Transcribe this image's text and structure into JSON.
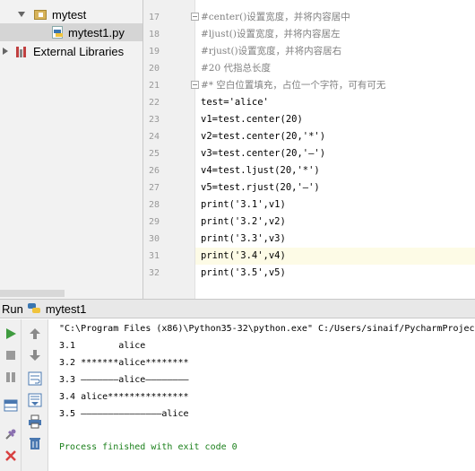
{
  "project_tree": {
    "items": [
      {
        "label": "mytest",
        "type": "folder",
        "expanded": true
      },
      {
        "label": "mytest1.py",
        "type": "python-file",
        "selected": true
      },
      {
        "label": "External Libraries",
        "type": "library",
        "expanded": false
      }
    ]
  },
  "editor": {
    "current_line": "31",
    "lines": [
      {
        "num": "17",
        "text": "#center()设置宽度，并将内容居中"
      },
      {
        "num": "18",
        "text": "#ljust()设置宽度，并将内容居左"
      },
      {
        "num": "19",
        "text": "#rjust()设置宽度，并将内容居右"
      },
      {
        "num": "20",
        "text": "#20 代指总长度"
      },
      {
        "num": "21",
        "text": "#* 空白位置填充，占位一个字符，可有可无"
      },
      {
        "num": "22",
        "text": "test='alice'"
      },
      {
        "num": "23",
        "text": "v1=test.center(20)"
      },
      {
        "num": "24",
        "text": "v2=test.center(20,'*')"
      },
      {
        "num": "25",
        "text": "v3=test.center(20,'—')"
      },
      {
        "num": "26",
        "text": "v4=test.ljust(20,'*')"
      },
      {
        "num": "27",
        "text": "v5=test.rjust(20,'—')"
      },
      {
        "num": "28",
        "text": "print('3.1',v1)"
      },
      {
        "num": "29",
        "text": "print('3.2',v2)"
      },
      {
        "num": "30",
        "text": "print('3.3',v3)"
      },
      {
        "num": "31",
        "text": "print('3.4',v4)"
      },
      {
        "num": "32",
        "text": "print('3.5',v5)"
      }
    ]
  },
  "run_panel": {
    "label": "Run",
    "config_name": "mytest1",
    "command": "\"C:\\Program Files (x86)\\Python35-32\\python.exe\" C:/Users/sinaif/PycharmProjec",
    "output": [
      "3.1        alice",
      "3.2 *******alice********",
      "3.3 ———————alice————————",
      "3.4 alice***************",
      "3.5 ———————————————alice",
      "",
      "Process finished with exit code 0"
    ]
  },
  "colors": {
    "comment": "#808080",
    "string": "#008080",
    "number": "#0000ff",
    "run_green": "#3f9b3f",
    "stop_red": "#d84040"
  },
  "icons": {
    "left_toolbar": [
      "run-icon",
      "stop-icon",
      "pause-icon",
      "layout-icon",
      "pin-icon",
      "close-icon"
    ],
    "right_toolbar": [
      "up-arrow-icon",
      "down-arrow-icon",
      "soft-wrap-icon",
      "scroll-to-end-icon",
      "print-icon",
      "trash-icon"
    ]
  }
}
